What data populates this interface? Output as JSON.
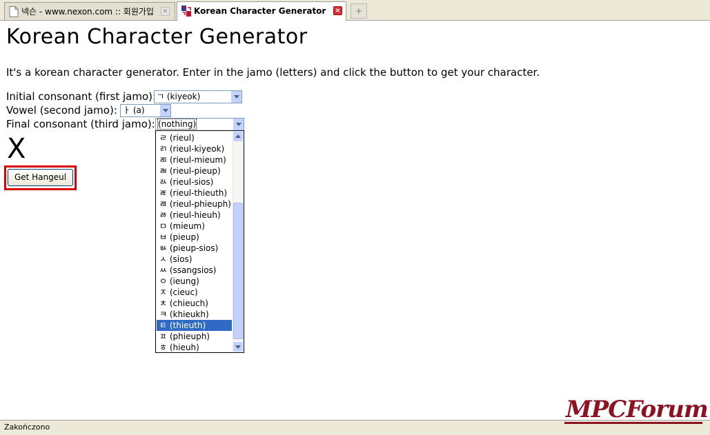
{
  "tabs": [
    {
      "label": "넥슨 - www.nexon.com :: 회원가입",
      "active": false
    },
    {
      "label": "Korean Character Generator",
      "active": true
    }
  ],
  "new_tab_symbol": "+",
  "page": {
    "title": "Korean Character Generator",
    "intro": "It's a korean character generator. Enter in the jamo (letters) and click the button to get your character.",
    "initial_label": "Initial consonant (first jamo):",
    "initial_value": "ㄱ (kiyeok)",
    "vowel_label": "Vowel (second jamo):",
    "vowel_value": "ㅏ (a)",
    "final_label": "Final consonant (third jamo):",
    "final_value": "(nothing)",
    "result_char": "X",
    "button_label": "Get Hangeul"
  },
  "dropdown": {
    "options": [
      "ㄹ (rieul)",
      "ㄺ (rieul-kiyeok)",
      "ㄻ (rieul-mieum)",
      "ㄼ (rieul-pieup)",
      "ㄽ (rieul-sios)",
      "ㄾ (rieul-thieuth)",
      "ㄿ (rieul-phieuph)",
      "ㅀ (rieul-hieuh)",
      "ㅁ (mieum)",
      "ㅂ (pieup)",
      "ㅄ (pieup-sios)",
      "ㅅ (sios)",
      "ㅆ (ssangsios)",
      "ㅇ (ieung)",
      "ㅈ (cieuc)",
      "ㅊ (chieuch)",
      "ㅋ (khieukh)",
      "ㅌ (thieuth)",
      "ㅍ (phieuph)",
      "ㅎ (hieuh)"
    ],
    "highlighted_index": 17
  },
  "status": "Zakończono",
  "watermark": "MPCForum",
  "colors": {
    "selection": "#316ac5",
    "highlight_frame": "#d80000",
    "watermark": "#8b1323"
  }
}
